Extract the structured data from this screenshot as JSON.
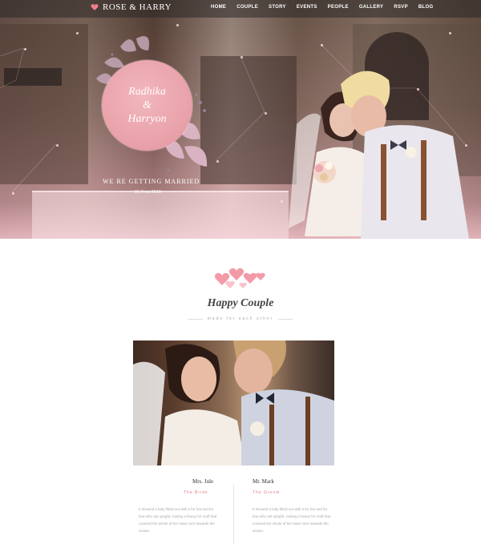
{
  "brand": {
    "name": "ROSE & HARRY",
    "accent": "#f07c8c"
  },
  "nav": {
    "items": [
      "HOME",
      "COUPLE",
      "STORY",
      "EVENTS",
      "PEOPLE",
      "GALLERY",
      "RSVP",
      "BLOG"
    ]
  },
  "hero": {
    "names": [
      "Radhika",
      "&",
      "Harryon"
    ],
    "tagline": "WE RE GETTING MARRIED",
    "date": "31 First 2019"
  },
  "couple_section": {
    "title": "Happy Couple",
    "subtitle": "made for each other",
    "bride": {
      "name": "Mrs. Jule",
      "role": "The Bride",
      "description": "It showed a lady fitted out with a fur hat and fur boa who sat upright, raising a heavy fur muff that covered the whole of her lower arm towards the viewer."
    },
    "groom": {
      "name": "Mr. Mark",
      "role": "The Groom",
      "description": "It showed a lady fitted out with a fur hat and fur boa who sat upright, raising a heavy fur muff that covered the whole of her lower arm towards the viewer."
    }
  },
  "colors": {
    "badge": "#e8a0a8",
    "role": "#e07a8a",
    "nav_bg": "#2d2828"
  }
}
